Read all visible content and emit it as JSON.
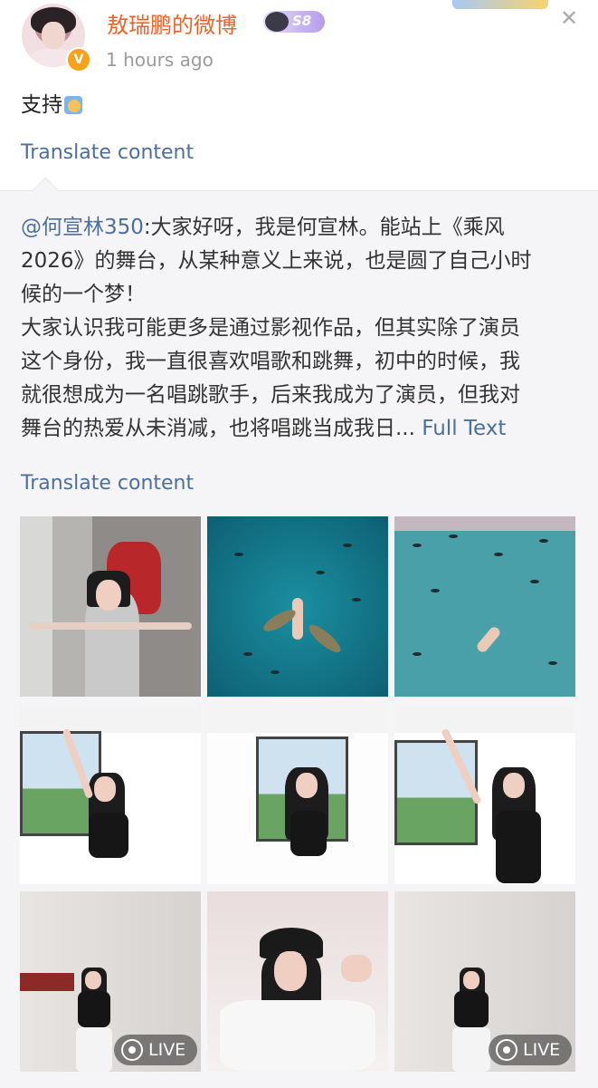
{
  "header": {
    "username": "敖瑞鹏的微博",
    "vip_level": "S8",
    "timestamp": "1 hours ago",
    "close_icon": "close-icon"
  },
  "post": {
    "text": "支持",
    "translate_label": "Translate content"
  },
  "repost": {
    "mention": "@何宣林350",
    "lines": [
      ":大家好呀，我是何宣林。能站上《乘风",
      "2026》的舞台，从某种意义上来说，也是圆了自己小时",
      "候的一个梦！",
      "大家认识我可能更多是通过影视作品，但其实除了演员",
      "这个身份，我一直很喜欢唱歌和跳舞，初中的时候，我",
      "就很想成为一名唱跳歌手，后来我成为了演员，但我对",
      "舞台的热爱从未消减，也将唱跳当成我日..."
    ],
    "full_text_label": "Full Text",
    "translate_label": "Translate content"
  },
  "photos": [
    {
      "live": false
    },
    {
      "live": false
    },
    {
      "live": false
    },
    {
      "live": false
    },
    {
      "live": false
    },
    {
      "live": false
    },
    {
      "live": true
    },
    {
      "live": false
    },
    {
      "live": true
    }
  ],
  "live_label": "LIVE"
}
